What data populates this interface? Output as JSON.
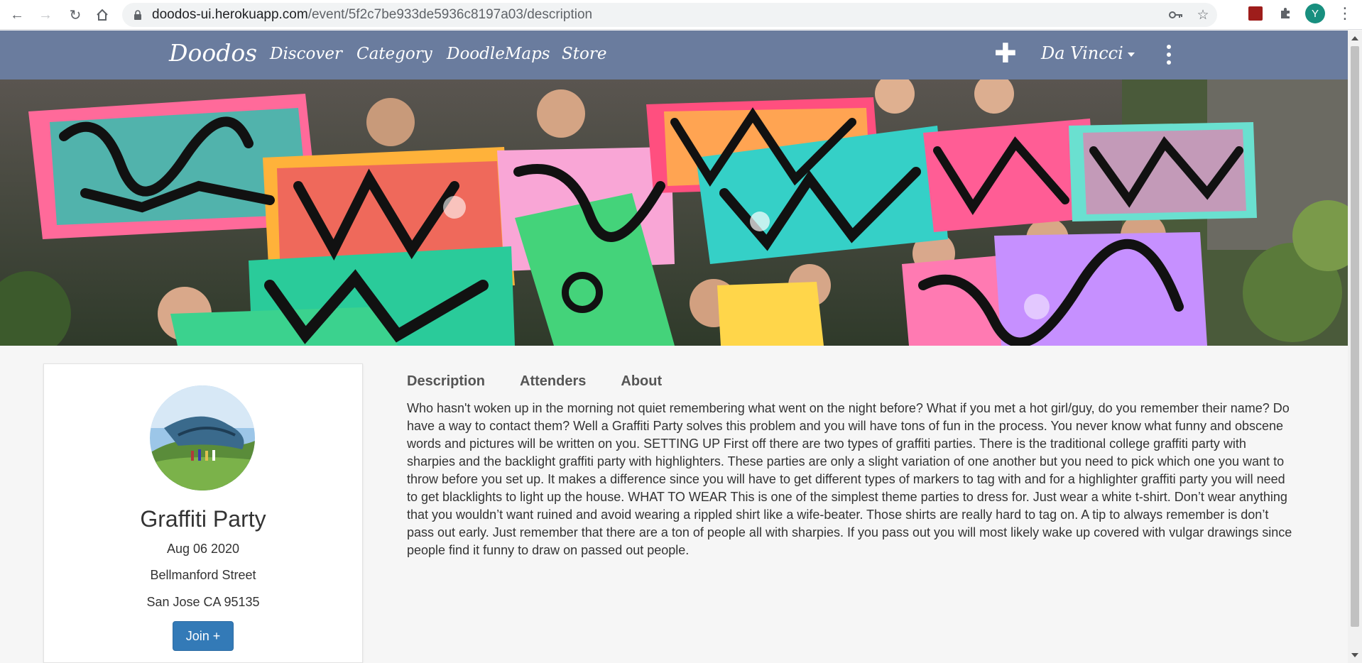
{
  "browser": {
    "url_host": "doodos-ui.herokuapp.com",
    "url_path": "/event/5f2c7be933de5936c8197a03/description",
    "profile_initial": "Y"
  },
  "navbar": {
    "brand": "Doodos",
    "links": [
      "Discover",
      "Category",
      "DoodleMaps",
      "Store"
    ],
    "add_icon": "plus-icon",
    "user": "Da Vincci",
    "bg_color": "#6a7c9e"
  },
  "event": {
    "title": "Graffiti Party",
    "date": "Aug 06 2020",
    "street": "Bellmanford Street",
    "city": "San Jose CA 95135",
    "join_label": "Join +"
  },
  "tabs": [
    "Description",
    "Attenders",
    "About"
  ],
  "description": "Who hasn't woken up in the morning not quiet remembering what went on the night before? What if you met a hot girl/guy, do you remember their name? Do have a way to contact them? Well a Graffiti Party solves this problem and you will have tons of fun in the process. You never know what funny and obscene words and pictures will be written on you. SETTING UP First off there are two types of graffiti parties. There is the traditional college graffiti party with sharpies and the backlight graffiti party with highlighters. These parties are only a slight variation of one another but you need to pick which one you want to throw before you set up. It makes a difference since you will have to get different types of markers to tag with and for a highlighter graffiti party you will need to get blacklights to light up the house. WHAT TO WEAR This is one of the simplest theme parties to dress for. Just wear a white t-shirt. Don’t wear anything that you wouldn’t want ruined and avoid wearing a rippled shirt like a wife-beater. Those shirts are really hard to tag on. A tip to always remember is don’t pass out early. Just remember that there are a ton of people all with sharpies. If you pass out you will most likely wake up covered with vulgar drawings since people find it funny to draw on passed out people."
}
